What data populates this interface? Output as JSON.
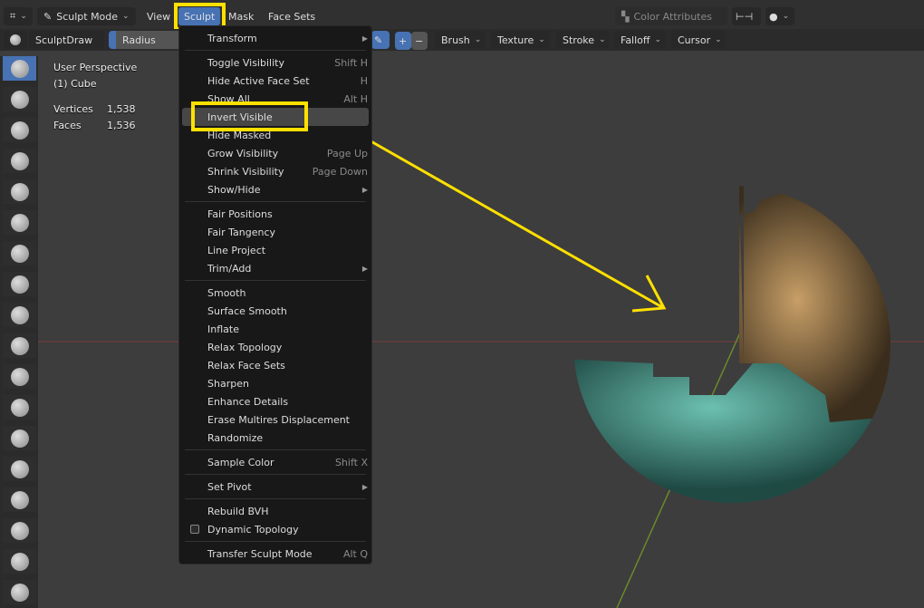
{
  "header": {
    "mode": "Sculpt Mode",
    "menus": [
      "View",
      "Sculpt",
      "Mask",
      "Face Sets"
    ],
    "color_attributes": "Color Attributes"
  },
  "toolbar": {
    "brush_name": "SculptDraw",
    "radius_label": "Radius",
    "dropdowns": [
      "Brush",
      "Texture",
      "Stroke",
      "Falloff",
      "Cursor"
    ]
  },
  "overlay": {
    "view": "User Perspective",
    "object": "(1) Cube",
    "stats": [
      {
        "label": "Vertices",
        "value": "1,538"
      },
      {
        "label": "Faces",
        "value": "1,536"
      }
    ]
  },
  "menu": {
    "items": [
      {
        "label": "Transform",
        "submenu": true
      },
      {
        "sep": true
      },
      {
        "label": "Toggle Visibility",
        "shortcut": "Shift H"
      },
      {
        "label": "Hide Active Face Set",
        "shortcut": "H"
      },
      {
        "label": "Show All",
        "shortcut": "Alt H"
      },
      {
        "label": "Invert Visible",
        "selected": true
      },
      {
        "label": "Hide Masked"
      },
      {
        "label": "Grow Visibility",
        "shortcut": "Page Up"
      },
      {
        "label": "Shrink Visibility",
        "shortcut": "Page Down"
      },
      {
        "label": "Show/Hide",
        "submenu": true
      },
      {
        "sep": true
      },
      {
        "label": "Fair Positions"
      },
      {
        "label": "Fair Tangency"
      },
      {
        "label": "Line Project"
      },
      {
        "label": "Trim/Add",
        "submenu": true
      },
      {
        "sep": true
      },
      {
        "label": "Smooth"
      },
      {
        "label": "Surface Smooth"
      },
      {
        "label": "Inflate"
      },
      {
        "label": "Relax Topology"
      },
      {
        "label": "Relax Face Sets"
      },
      {
        "label": "Sharpen"
      },
      {
        "label": "Enhance Details"
      },
      {
        "label": "Erase Multires Displacement"
      },
      {
        "label": "Randomize"
      },
      {
        "sep": true
      },
      {
        "label": "Sample Color",
        "shortcut": "Shift X"
      },
      {
        "sep": true
      },
      {
        "label": "Set Pivot",
        "submenu": true
      },
      {
        "sep": true
      },
      {
        "label": "Rebuild BVH"
      },
      {
        "label": "Dynamic Topology",
        "checkbox": true
      },
      {
        "sep": true
      },
      {
        "label": "Transfer Sculpt Mode",
        "shortcut": "Alt Q"
      }
    ]
  },
  "colors": {
    "highlight": "#ffe000",
    "accent": "#4772b3",
    "teal": "#4f9d8f",
    "tan": "#b08a58"
  }
}
